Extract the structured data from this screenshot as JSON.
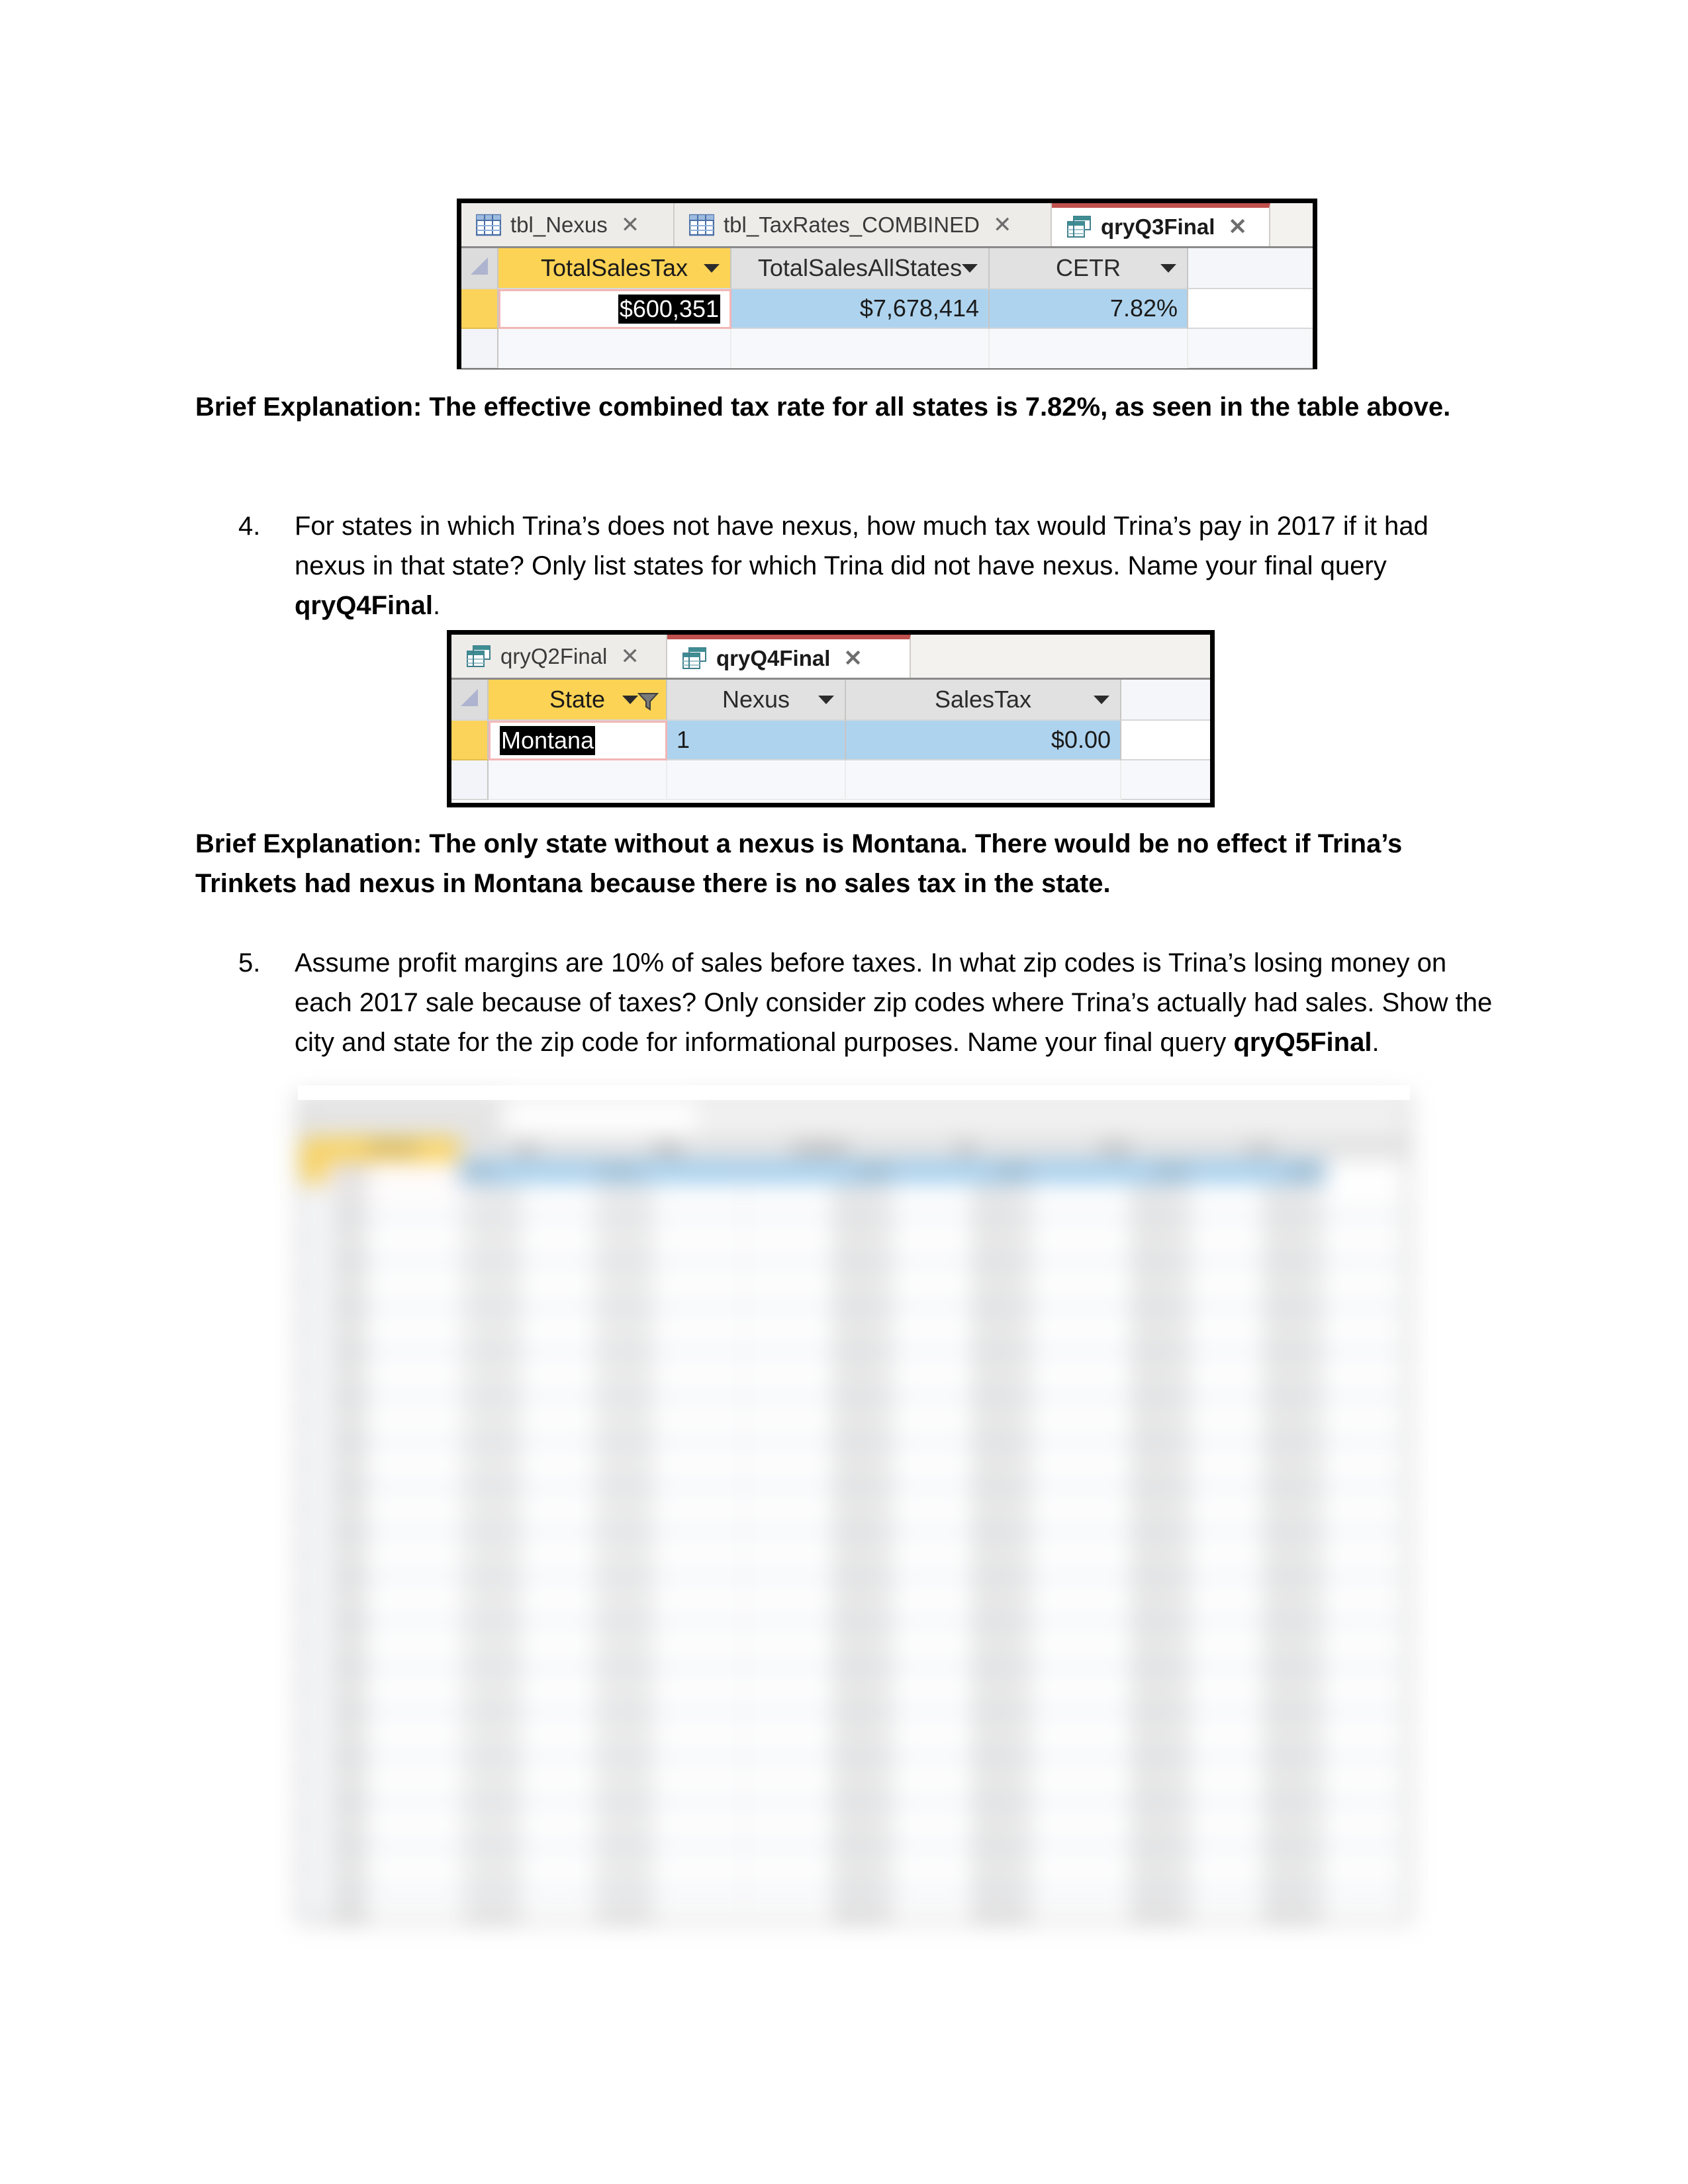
{
  "document": {
    "explanation_3": "Brief Explanation: The effective combined tax rate for all states is 7.82%, as seen in the table above.",
    "item4": {
      "number": "4.",
      "text_part1": "For states in which Trina’s does not have nexus, how much tax would Trina’s pay in 2017 if it had nexus in that state? Only list states for which Trina did not have nexus. Name your final query ",
      "query_name": "qryQ4Final",
      "text_part2": "."
    },
    "explanation_4": "Brief Explanation: The only state without a nexus is Montana. There would be no effect if Trina’s Trinkets had nexus in Montana because there is no sales tax in the state.",
    "item5": {
      "number": "5.",
      "text_part1": "Assume profit margins are 10% of sales before taxes. In what zip codes is Trina’s losing money on each 2017 sale because of taxes? Only consider zip codes where Trina’s actually had sales. Show the city and state for the zip code for informational purposes. Name your final query ",
      "query_name": "qryQ5Final",
      "text_part2": "."
    }
  },
  "screenshot_q3": {
    "tabs": [
      {
        "label": "tbl_Nexus",
        "icon": "table-icon",
        "active": false,
        "close": "✕"
      },
      {
        "label": "tbl_TaxRates_COMBINED",
        "icon": "table-icon",
        "active": false,
        "close": "✕"
      },
      {
        "label": "qryQ3Final",
        "icon": "query-icon",
        "active": true,
        "close": "✕"
      }
    ],
    "columns": [
      {
        "name": "TotalSalesTax",
        "highlighted": true
      },
      {
        "name": "TotalSalesAllStates",
        "highlighted": false
      },
      {
        "name": "CETR",
        "highlighted": false
      }
    ],
    "row": [
      {
        "value": "$600,351",
        "selected_text": true,
        "align": "right"
      },
      {
        "value": "$7,678,414",
        "selected_text": false,
        "align": "right"
      },
      {
        "value": "7.82%",
        "selected_text": false,
        "align": "right"
      }
    ]
  },
  "screenshot_q4": {
    "tabs": [
      {
        "label": "qryQ2Final",
        "icon": "query-icon",
        "active": false,
        "close": "✕"
      },
      {
        "label": "qryQ4Final",
        "icon": "query-icon",
        "active": true,
        "close": "✕"
      }
    ],
    "columns": [
      {
        "name": "State",
        "highlighted": true,
        "filtered": true
      },
      {
        "name": "Nexus",
        "highlighted": false,
        "filtered": false
      },
      {
        "name": "SalesTax",
        "highlighted": false,
        "filtered": false
      }
    ],
    "row": [
      {
        "value": "Montana",
        "selected_text": true,
        "align": "left"
      },
      {
        "value": "1",
        "selected_text": false,
        "align": "left"
      },
      {
        "value": "$0.00",
        "selected_text": false,
        "align": "right"
      }
    ]
  },
  "screenshot_q5": {
    "blurred": true,
    "description": "blurred Access datasheet screenshot"
  },
  "colors": {
    "header_highlight": "#fcd354",
    "selected_row": "#aed3ee",
    "active_tab_accent": "#c0504d",
    "selection_black": "#000000",
    "row_selector": "#fbd35b",
    "frame_border": "#000000"
  }
}
